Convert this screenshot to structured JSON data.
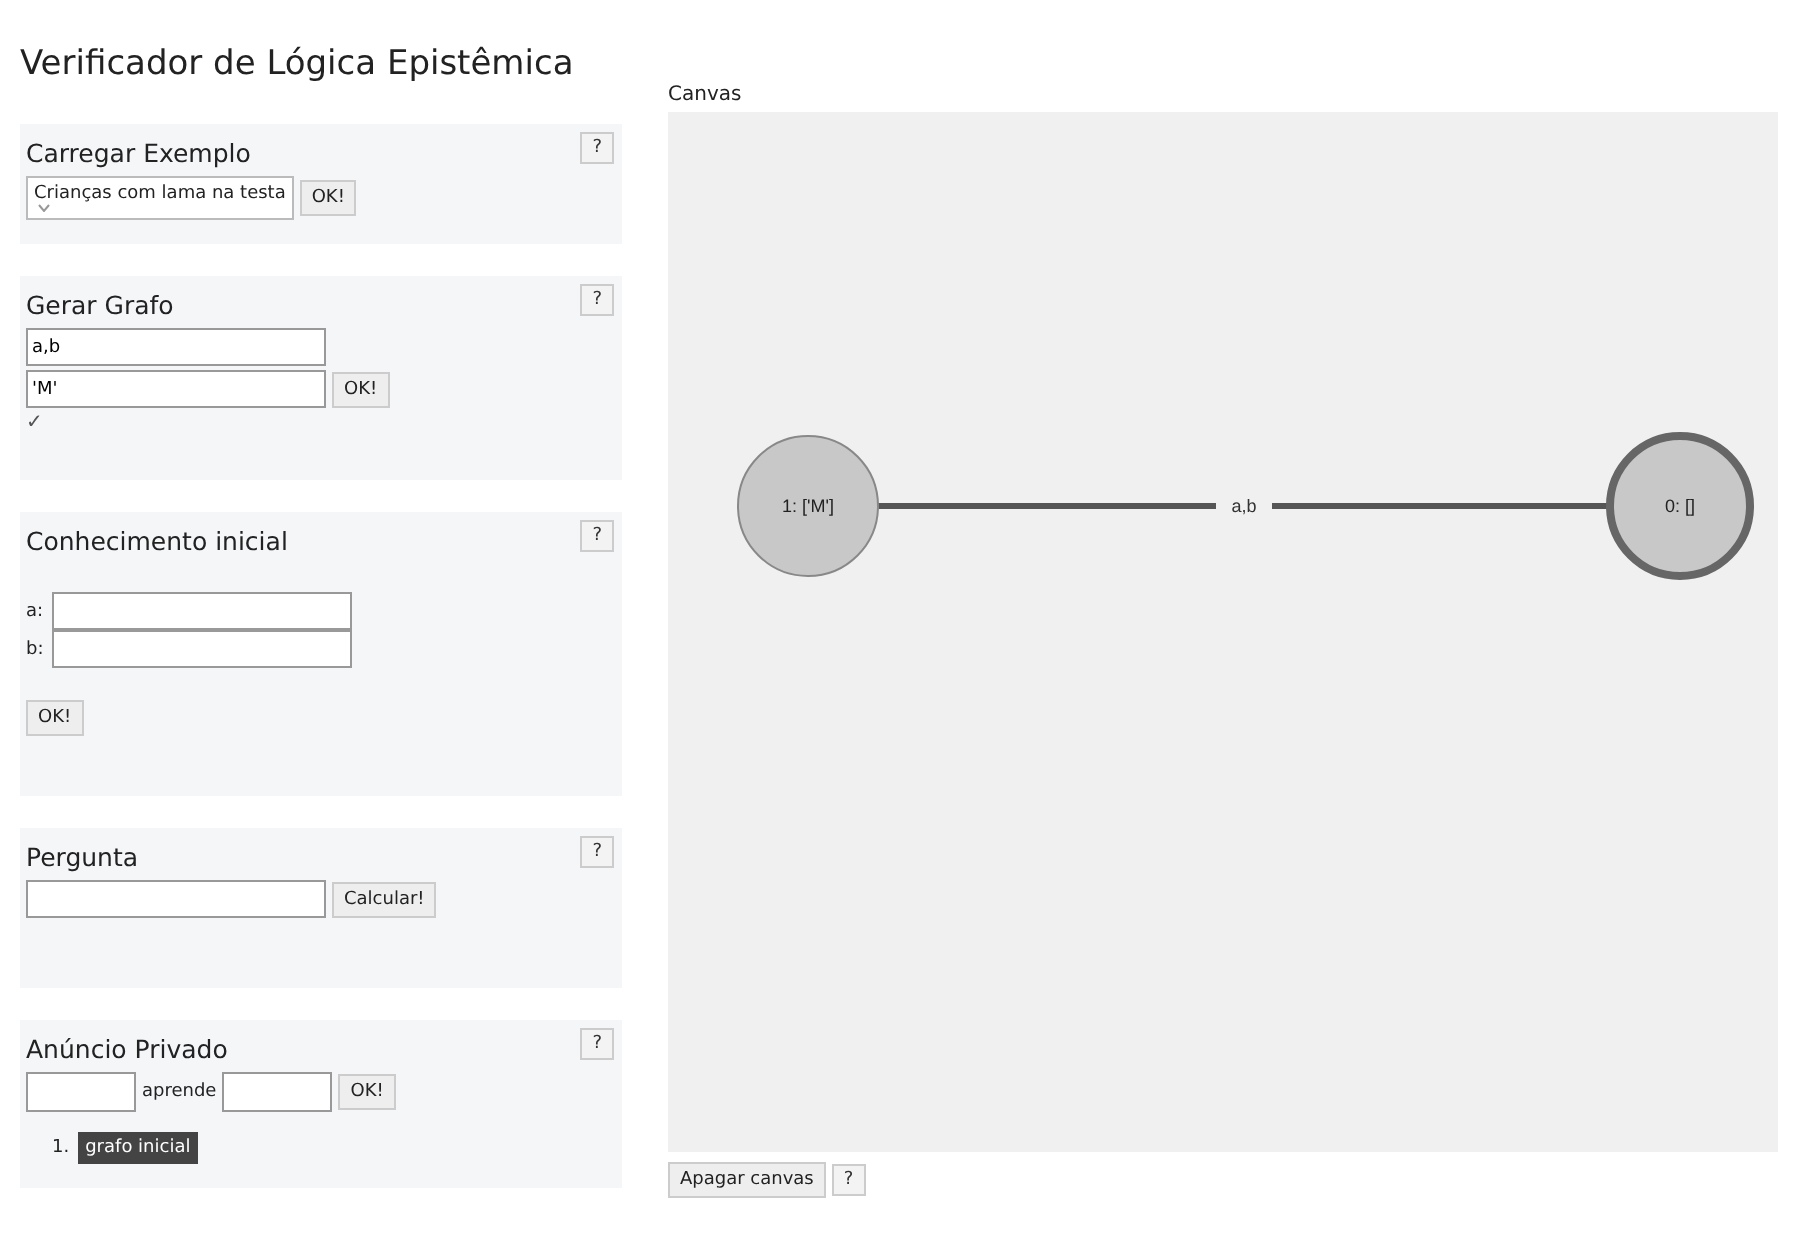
{
  "title": "Verificador de Lógica Epistêmica",
  "panels": [
    {
      "kind": "example",
      "title": "Carregar Exemplo",
      "help": "?",
      "select": "Crianças com lama na testa",
      "button": "OK!"
    },
    {
      "kind": "graph",
      "title": "Gerar Grafo",
      "help": "?",
      "fields": [
        "a,b",
        "'M'"
      ],
      "button": "OK!",
      "status": "✓"
    },
    {
      "kind": "knowledge",
      "title": "Conhecimento inicial",
      "help": "?",
      "fields": [
        {
          "label": "a:"
        },
        {
          "label": "b:"
        }
      ],
      "button": "OK!"
    },
    {
      "kind": "question",
      "title": "Pergunta",
      "help": "?",
      "button": "Calcular!"
    },
    {
      "kind": "announce",
      "title": "Anúncio Privado",
      "help": "?",
      "middle": "aprende",
      "button": "OK!",
      "history": [
        {
          "number": "1.",
          "label": "grafo inicial"
        }
      ]
    }
  ],
  "canvas": {
    "label": "Canvas",
    "nodes": [
      {
        "label": "1: ['M']",
        "current": false
      },
      {
        "label": "0: []",
        "current": true
      }
    ],
    "edge": "a,b",
    "clear_button": "Apagar canvas",
    "help": "?"
  }
}
